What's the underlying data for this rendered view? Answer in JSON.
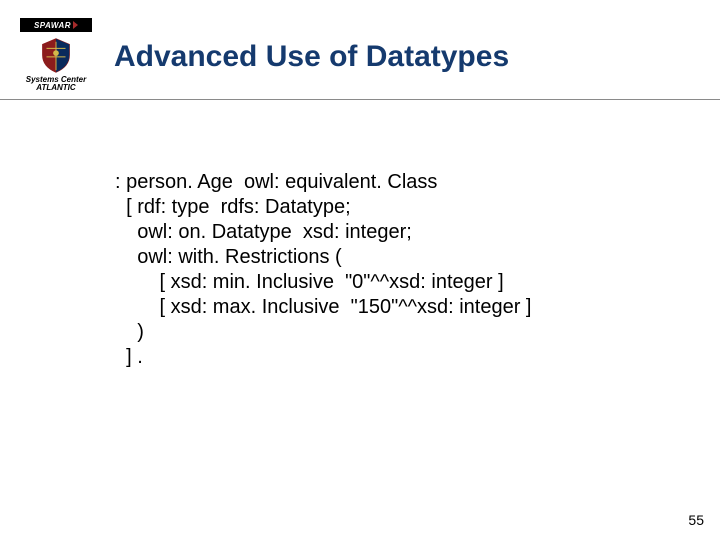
{
  "header": {
    "org_bar_label": "SPAWAR",
    "org_sub_line1": "Systems Center",
    "org_sub_line2": "ATLANTIC",
    "title": "Advanced Use of Datatypes"
  },
  "code": {
    "l1": ": person. Age  owl: equivalent. Class",
    "l2": "  [ rdf: type  rdfs: Datatype;",
    "l3": "    owl: on. Datatype  xsd: integer;",
    "l4": "    owl: with. Restrictions (",
    "l5": "        [ xsd: min. Inclusive  \"0\"^^xsd: integer ]",
    "l6": "        [ xsd: max. Inclusive  \"150\"^^xsd: integer ]",
    "l7": "    )",
    "l8": "  ] ."
  },
  "page_number": "55"
}
